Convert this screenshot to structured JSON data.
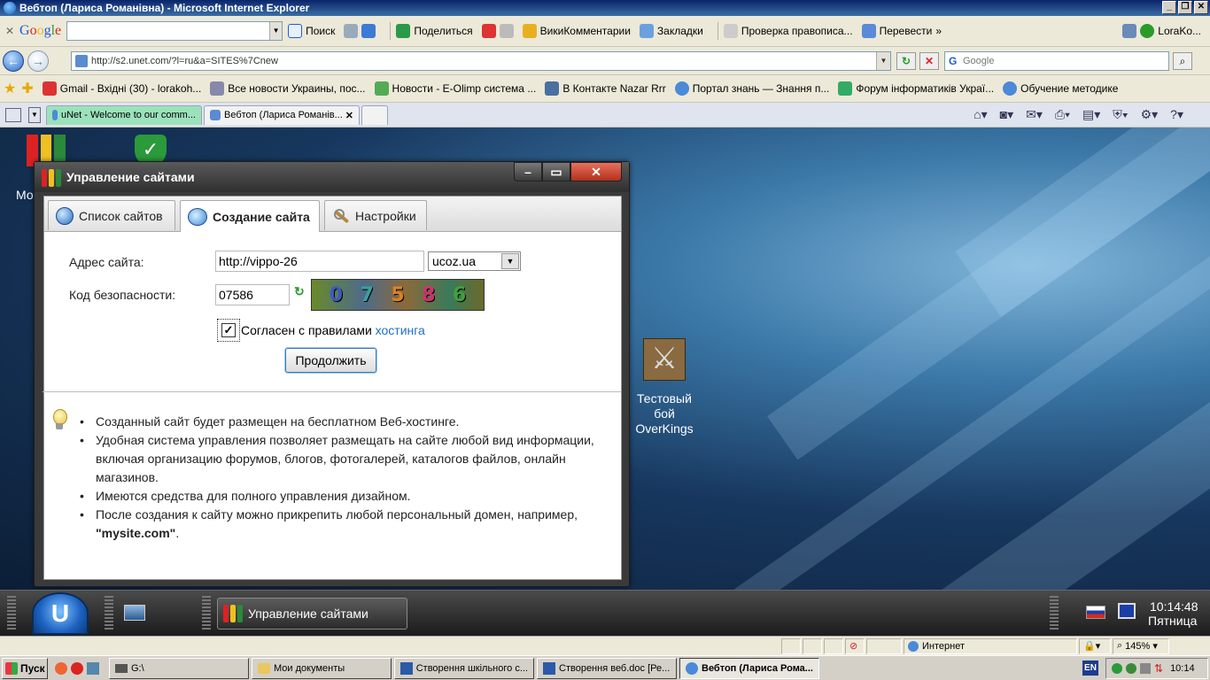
{
  "browser": {
    "title": "Вебтоп (Лариса Романівна) - Microsoft Internet Explorer",
    "google_toolbar": {
      "logo": "Google",
      "items": [
        "Поиск",
        "Поделиться",
        "ВикиКомментарии",
        "Закладки",
        "Проверка правописа...",
        "Перевести",
        "LoraKo..."
      ]
    },
    "address": "http://s2.unet.com/?l=ru&a=SITES%7Cnew",
    "search_placeholder": "Google",
    "favorites": [
      "Gmail - Вхідні (30) - lorakoh...",
      "Все новости Украины, пос...",
      "Новости - E-Olimp система ...",
      "В Контакте  Nazar Rrr",
      "Портал знань — Знання п...",
      "Форум інформатиків Украї...",
      "Обучение методике"
    ],
    "tabs": [
      {
        "label": "uNet - Welcome to our comm..."
      },
      {
        "label": "Вебтоп (Лариса Романів..."
      }
    ],
    "zoom": "145%",
    "status_zone": "Интернет"
  },
  "desktop": {
    "icon_left_label": "Мо",
    "icon_game_label_lines": [
      "Тестовый",
      "бой",
      "OverKings"
    ]
  },
  "window": {
    "title": "Управление сайтами",
    "tabs": [
      "Список сайтов",
      "Создание сайта",
      "Настройки"
    ],
    "form": {
      "address_label": "Адрес сайта:",
      "address_prefix": "http://",
      "address_value": "vippo-26",
      "domain_value": "ucoz.ua",
      "security_label": "Код безопасности:",
      "security_value": "07586",
      "captcha_chars": [
        "0",
        "7",
        "5",
        "8",
        "6"
      ],
      "agree_text": "Согласен с правилами",
      "agree_link": "хостинга",
      "agree_checked": true,
      "continue_button": "Продолжить"
    },
    "info": {
      "bullet1": "Созданный сайт будет размещен на бесплатном Веб-хостинге.",
      "bullet2": "Удобная система управления позволяет размещать на сайте любой вид информации, включая организацию форумов, блогов, фотогалерей, каталогов файлов, онлайн магазинов.",
      "bullet3": "Имеются средства для полного управления дизайном.",
      "bullet4_text": "После создания к сайту можно прикрепить любой персональный домен, например,",
      "bullet4_domain": "\"mysite.com\"",
      "bullet4_end": "."
    }
  },
  "webos_taskbar": {
    "start_label": "U",
    "task_label": "Управление сайтами",
    "time": "10:14:48",
    "day": "Пятница"
  },
  "os_taskbar": {
    "start": "Пуск",
    "items": [
      "G:\\",
      "Мои документы",
      "Створення шкільного с...",
      "Створення веб.doc [Ре...",
      "Вебтоп (Лариса Рома..."
    ],
    "lang": "EN",
    "time": "10:14"
  }
}
